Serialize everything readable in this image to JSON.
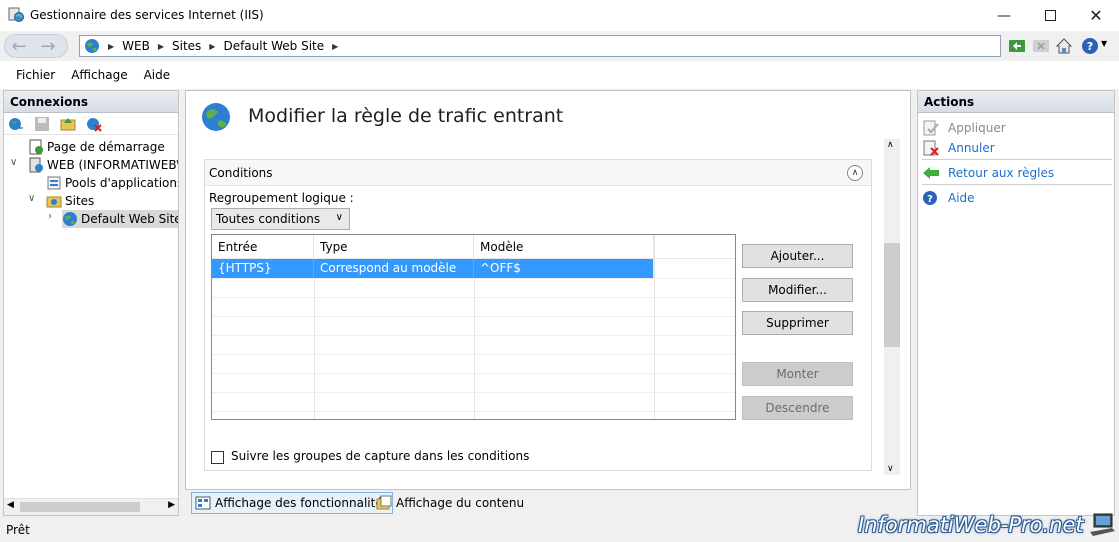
{
  "window": {
    "title": "Gestionnaire des services Internet (IIS)"
  },
  "address": {
    "crumbs": [
      "WEB",
      "Sites",
      "Default Web Site"
    ]
  },
  "menu": {
    "items": [
      "Fichier",
      "Affichage",
      "Aide"
    ]
  },
  "connections": {
    "header": "Connexions",
    "tree": {
      "start_page": "Page de démarrage",
      "server": "WEB (INFORMATIWEB\\Ad",
      "app_pools": "Pools d'applications",
      "sites": "Sites",
      "default_site": "Default Web Site"
    }
  },
  "main": {
    "title": "Modifier la règle de trafic entrant",
    "conditions": {
      "title": "Conditions",
      "group_label": "Regroupement logique :",
      "group_value": "Toutes conditions",
      "columns": [
        "Entrée",
        "Type",
        "Modèle"
      ],
      "rows": [
        {
          "input": "{HTTPS}",
          "type": "Correspond au modèle",
          "pattern": "^OFF$"
        }
      ],
      "buttons": {
        "add": "Ajouter...",
        "edit": "Modifier...",
        "remove": "Supprimer",
        "up": "Monter",
        "down": "Descendre"
      },
      "track_groups_label": "Suivre les groupes de capture dans les conditions",
      "track_groups_checked": false
    }
  },
  "views": {
    "features": "Affichage des fonctionnalités",
    "content": "Affichage du contenu"
  },
  "actions": {
    "header": "Actions",
    "apply": "Appliquer",
    "cancel": "Annuler",
    "back": "Retour aux règles",
    "help": "Aide"
  },
  "status": {
    "text": "Prêt"
  },
  "watermark": "InformatiWeb-Pro.net",
  "colors": {
    "selection": "#3399ff",
    "link": "#1c6ec8",
    "header_gradient": "#d6dde6"
  }
}
